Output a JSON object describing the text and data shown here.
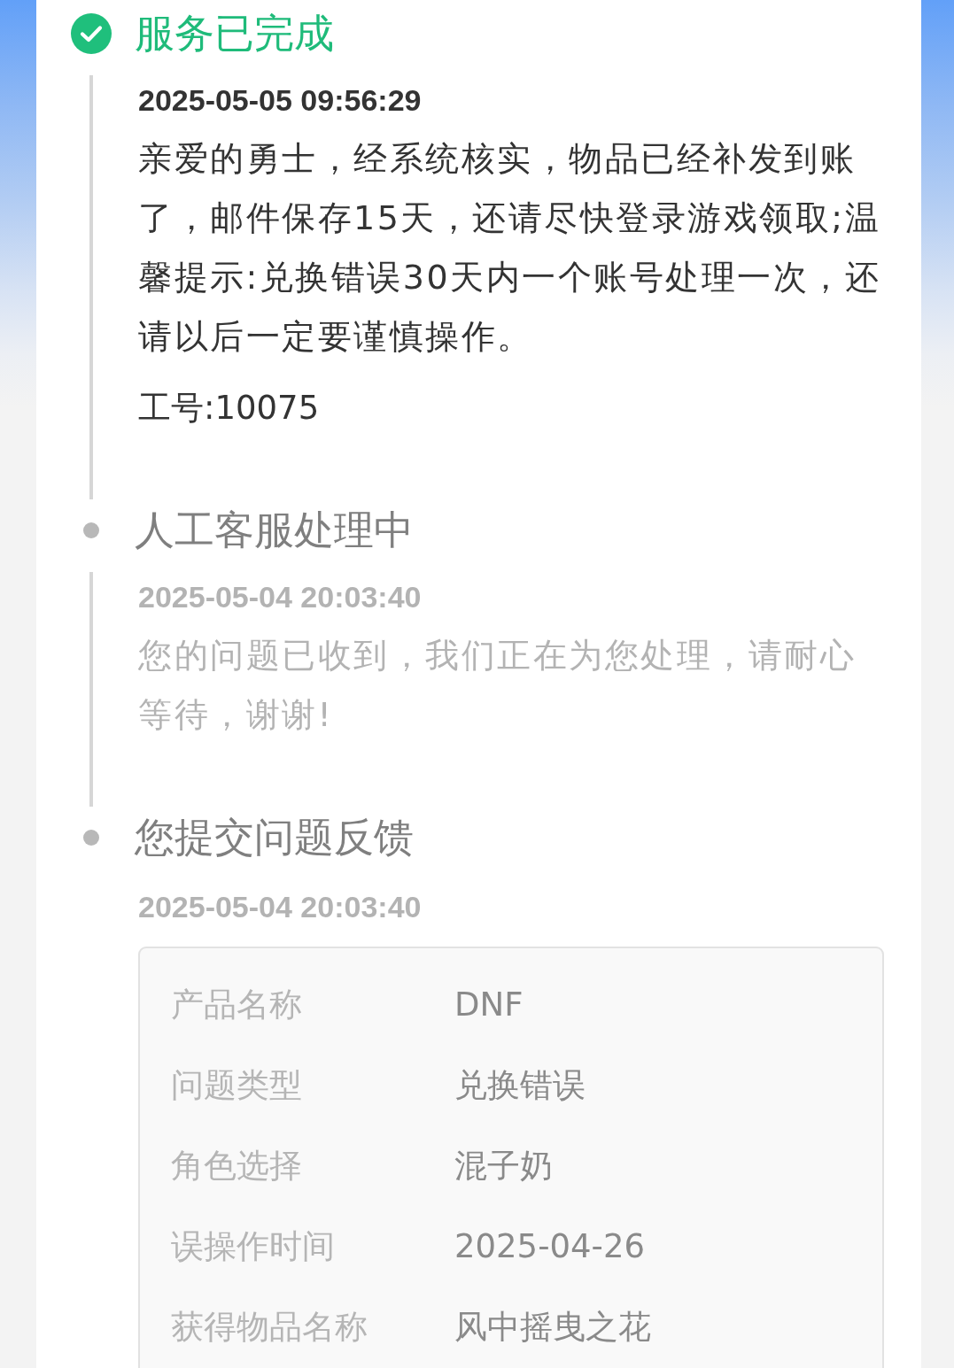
{
  "timeline": [
    {
      "kind": "done",
      "title": "服务已完成",
      "time": "2025-05-05 09:56:29",
      "message": "亲爱的勇士，经系统核实，物品已经补发到账了，邮件保存15天，还请尽快登录游戏领取;温馨提示:兑换错误30天内一个账号处理一次，还请以后一定要谨慎操作。",
      "staff_id": "工号:10075"
    },
    {
      "kind": "step",
      "title": "人工客服处理中",
      "time": "2025-05-04 20:03:40",
      "message": "您的问题已收到，我们正在为您处理，请耐心等待，谢谢!"
    },
    {
      "kind": "step",
      "title": "您提交问题反馈",
      "time": "2025-05-04 20:03:40",
      "details": [
        {
          "label": "产品名称",
          "value": "DNF"
        },
        {
          "label": "问题类型",
          "value": "兑换错误"
        },
        {
          "label": "角色选择",
          "value": "混子奶"
        },
        {
          "label": "误操作时间",
          "value": "2025-04-26"
        },
        {
          "label": "获得物品名称",
          "value": "风中摇曳之花"
        }
      ]
    }
  ]
}
